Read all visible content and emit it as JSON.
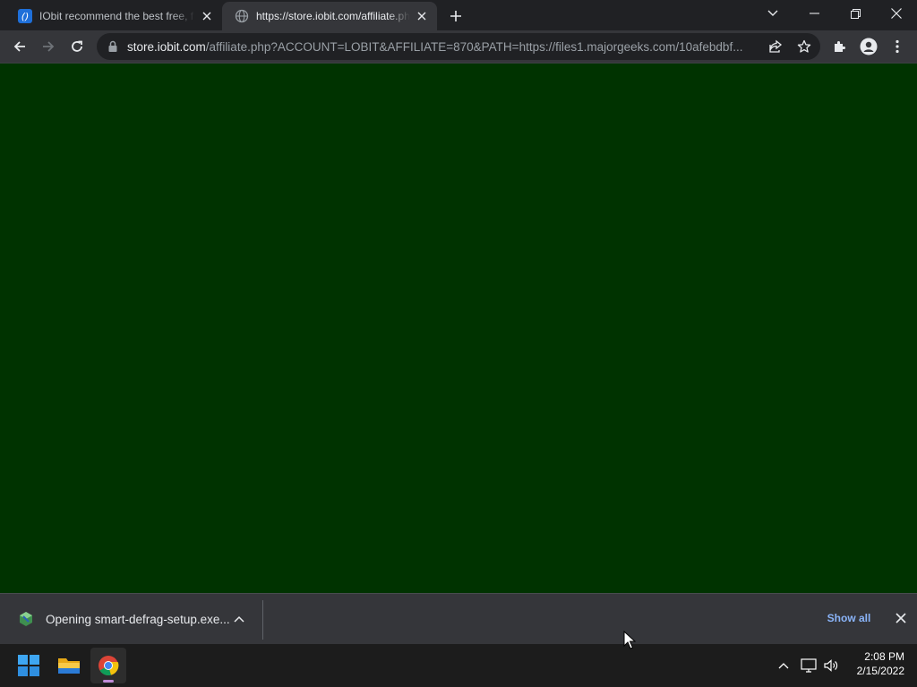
{
  "browser": {
    "tabs": [
      {
        "title": "IObit recommend the best free, f",
        "favicon": "iobit-favicon",
        "active": false
      },
      {
        "title": "https://store.iobit.com/affiliate.php",
        "favicon": "globe-icon",
        "active": true
      }
    ],
    "address_bar": {
      "host": "store.iobit.com",
      "path": "/affiliate.php?ACCOUNT=LOBIT&AFFILIATE=870&PATH=https://files1.majorgeeks.com/10afebdbf..."
    },
    "page_background": "#003300"
  },
  "download_shelf": {
    "item_label": "Opening smart-defrag-setup.exe...",
    "show_all_label": "Show all"
  },
  "taskbar": {
    "pinned": [
      "windows-start-icon",
      "file-explorer-icon",
      "chrome-icon"
    ],
    "tray": [
      "chevron-up-icon",
      "network-icon",
      "volume-icon"
    ],
    "time": "2:08 PM",
    "date": "2/15/2022"
  },
  "colors": {
    "tab_strip": "#202124",
    "toolbar": "#35363a",
    "accent_link": "#8ab4f8",
    "taskbar": "#1c1c1c"
  }
}
